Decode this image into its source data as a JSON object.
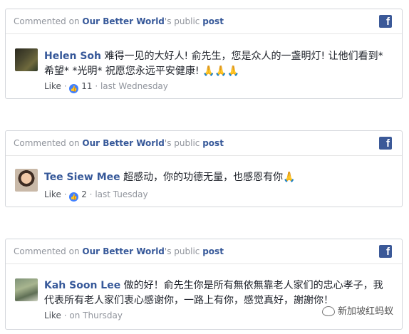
{
  "cards": [
    {
      "header": {
        "prefix": "Commented on",
        "page": "Our Better World",
        "suffix": "'s public",
        "post": "post"
      },
      "author": "Helen Soh",
      "comment": "难得一见的大好人! 俞先生，您是众人的一盏明灯! 让他们看到*希望* *光明* 祝愿您永远平安健康! 🙏🙏🙏",
      "like_label": "Like",
      "like_count": "11",
      "time": "last Wednesday"
    },
    {
      "header": {
        "prefix": "Commented on",
        "page": "Our Better World",
        "suffix": "'s public",
        "post": "post"
      },
      "author": "Tee Siew Mee",
      "comment": "超感动，你的功德无量，也感恩有你🙏",
      "like_label": "Like",
      "like_count": "2",
      "time": "last Tuesday"
    },
    {
      "header": {
        "prefix": "Commented on",
        "page": "Our Better World",
        "suffix": "'s public",
        "post": "post"
      },
      "author": "Kah Soon Lee",
      "comment": "做的好！俞先生你是所有無依無靠老人家们的忠心孝子，我代表所有老人家们衷心感谢你，一路上有你，感觉真好，謝謝你！",
      "like_label": "Like",
      "time": "on Thursday"
    }
  ],
  "fb_icon_glyph": "f",
  "like_badge_glyph": "👍",
  "watermark": "新加坡红蚂蚁",
  "colors": {
    "link": "#365899",
    "muted": "#90949c",
    "facebook_blue": "#3b5998",
    "like_blue": "#4080ff"
  }
}
